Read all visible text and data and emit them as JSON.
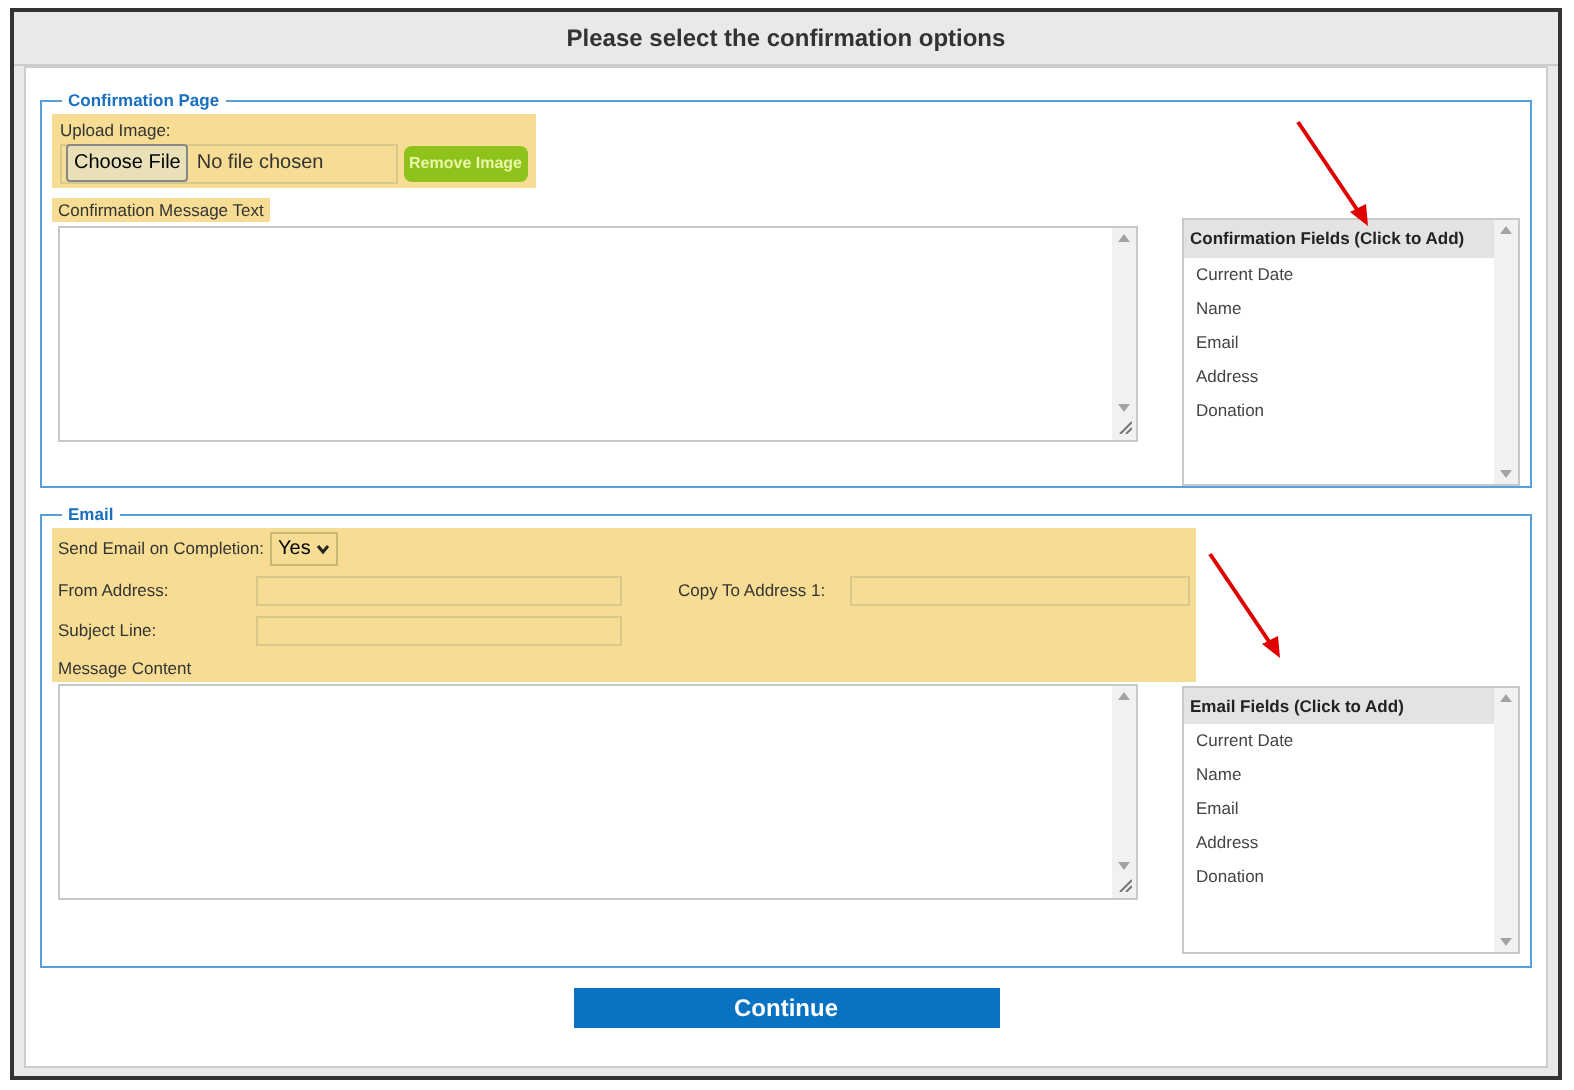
{
  "title": "Please select the confirmation options",
  "confirmation": {
    "legend": "Confirmation Page",
    "upload_label": "Upload Image:",
    "choose_button": "Choose File",
    "file_status": "No file chosen",
    "remove_button": "Remove Image",
    "message_label": "Confirmation Message Text",
    "fields_header": "Confirmation Fields (Click to Add)",
    "fields": [
      "Current Date",
      "Name",
      "Email",
      "Address",
      "Donation"
    ]
  },
  "email": {
    "legend": "Email",
    "send_label": "Send Email on Completion:",
    "send_value": "Yes",
    "from_label": "From Address:",
    "copy_label": "Copy To Address 1:",
    "subject_label": "Subject Line:",
    "message_label": "Message Content",
    "fields_header": "Email Fields (Click to Add)",
    "fields": [
      "Current Date",
      "Name",
      "Email",
      "Address",
      "Donation"
    ]
  },
  "continue_button": "Continue"
}
